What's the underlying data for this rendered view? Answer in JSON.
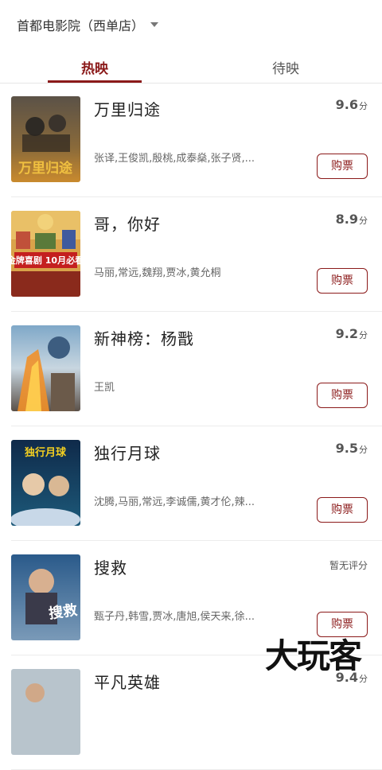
{
  "header": {
    "cinema_name": "首都电影院（西单店）"
  },
  "tabs": [
    {
      "label": "热映"
    },
    {
      "label": "待映"
    }
  ],
  "movies": [
    {
      "title": "万里归途",
      "score": "9.6",
      "score_unit": "分",
      "cast": "张译,王俊凯,殷桃,成泰燊,张子贤,...",
      "buy_label": "购票"
    },
    {
      "title": "哥，你好",
      "score": "8.9",
      "score_unit": "分",
      "cast": "马丽,常远,魏翔,贾冰,黄允桐",
      "buy_label": "购票"
    },
    {
      "title": "新神榜：杨戬",
      "score": "9.2",
      "score_unit": "分",
      "cast": "王凯",
      "buy_label": "购票"
    },
    {
      "title": "独行月球",
      "score": "9.5",
      "score_unit": "分",
      "cast": "沈腾,马丽,常远,李诚儒,黄才伦,辣...",
      "buy_label": "购票"
    },
    {
      "title": "搜救",
      "score_text": "暂无评分",
      "cast": "甄子丹,韩雪,贾冰,唐旭,侯天来,徐...",
      "buy_label": "购票"
    },
    {
      "title": "平凡英雄",
      "score": "9.4",
      "score_unit": "分"
    }
  ],
  "posters": [
    {
      "text": "万里归途"
    },
    {
      "text": "金牌喜剧 10月必看"
    },
    {
      "text": ""
    },
    {
      "text": "独行月球"
    },
    {
      "text": "搜救"
    },
    {
      "text": ""
    }
  ],
  "watermark": "大玩客",
  "colors": {
    "accent": "#8b1a1a",
    "divider": "#ececec"
  }
}
